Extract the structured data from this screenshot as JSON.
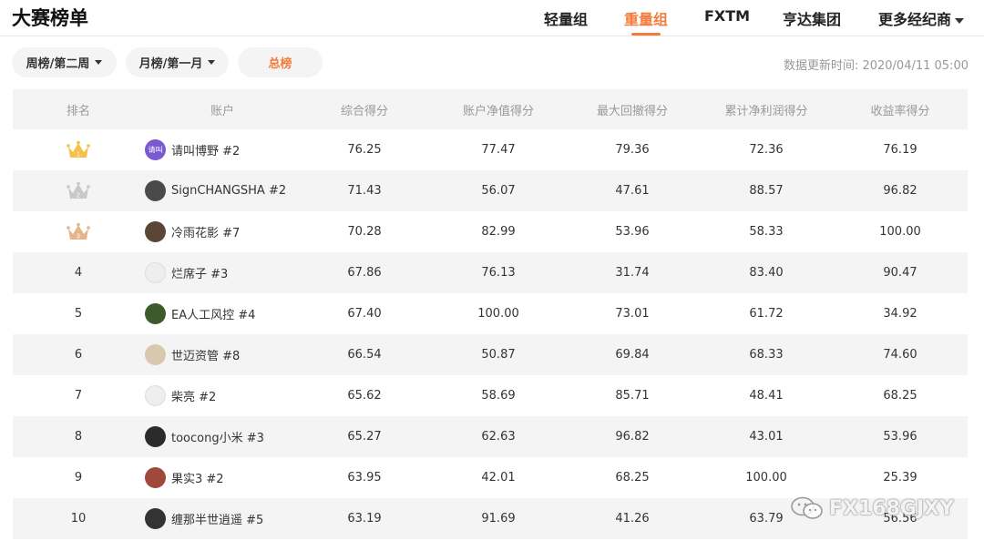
{
  "header": {
    "title": "大赛榜单",
    "nav": [
      {
        "label": "轻量组",
        "active": false
      },
      {
        "label": "重量组",
        "active": true
      },
      {
        "label": "FXTM",
        "active": false
      },
      {
        "label": "亨达集团",
        "active": false
      },
      {
        "label": "更多经纪商",
        "active": false,
        "dropdown": true
      }
    ]
  },
  "filters": {
    "week": "周榜/第二周",
    "month": "月榜/第一月",
    "total": "总榜",
    "updated": "数据更新时间: 2020/04/11 05:00"
  },
  "table": {
    "columns": [
      "排名",
      "账户",
      "综合得分",
      "账户净值得分",
      "最大回撤得分",
      "累计净利润得分",
      "收益率得分"
    ],
    "rows": [
      {
        "rank": "1",
        "account": "请叫博野 #2",
        "s1": "76.25",
        "s2": "77.47",
        "s3": "79.36",
        "s4": "72.36",
        "s5": "76.19",
        "avatar_text": "请叫",
        "avatar_color": "#7b5ad1"
      },
      {
        "rank": "2",
        "account": "SignCHANGSHA #2",
        "s1": "71.43",
        "s2": "56.07",
        "s3": "47.61",
        "s4": "88.57",
        "s5": "96.82",
        "avatar_text": "",
        "avatar_color": "#4a4a4a"
      },
      {
        "rank": "3",
        "account": "冷雨花影 #7",
        "s1": "70.28",
        "s2": "82.99",
        "s3": "53.96",
        "s4": "58.33",
        "s5": "100.00",
        "avatar_text": "",
        "avatar_color": "#5a4636"
      },
      {
        "rank": "4",
        "account": "烂席子 #3",
        "s1": "67.86",
        "s2": "76.13",
        "s3": "31.74",
        "s4": "83.40",
        "s5": "90.47",
        "avatar_text": "",
        "avatar_color": "#eeeeee"
      },
      {
        "rank": "5",
        "account": "EA人工风控 #4",
        "s1": "67.40",
        "s2": "100.00",
        "s3": "73.01",
        "s4": "61.72",
        "s5": "34.92",
        "avatar_text": "",
        "avatar_color": "#3d5a2a"
      },
      {
        "rank": "6",
        "account": "世迈资管 #8",
        "s1": "66.54",
        "s2": "50.87",
        "s3": "69.84",
        "s4": "68.33",
        "s5": "74.60",
        "avatar_text": "",
        "avatar_color": "#d9c7b0"
      },
      {
        "rank": "7",
        "account": "柴亮 #2",
        "s1": "65.62",
        "s2": "58.69",
        "s3": "85.71",
        "s4": "48.41",
        "s5": "68.25",
        "avatar_text": "",
        "avatar_color": "#eeeeee"
      },
      {
        "rank": "8",
        "account": "toocong小米 #3",
        "s1": "65.27",
        "s2": "62.63",
        "s3": "96.82",
        "s4": "43.01",
        "s5": "53.96",
        "avatar_text": "",
        "avatar_color": "#2b2b2b"
      },
      {
        "rank": "9",
        "account": "果实3 #2",
        "s1": "63.95",
        "s2": "42.01",
        "s3": "68.25",
        "s4": "100.00",
        "s5": "25.39",
        "avatar_text": "",
        "avatar_color": "#a0483a"
      },
      {
        "rank": "10",
        "account": "缠那半世逍遥 #5",
        "s1": "63.19",
        "s2": "91.69",
        "s3": "41.26",
        "s4": "63.79",
        "s5": "56.56",
        "avatar_text": "",
        "avatar_color": "#333333"
      }
    ]
  },
  "watermark": "FX168GJXY",
  "colors": {
    "accent": "#f37b3b",
    "gold": "#f5c14a",
    "silver": "#c8c8c8",
    "bronze": "#e4b48a"
  }
}
